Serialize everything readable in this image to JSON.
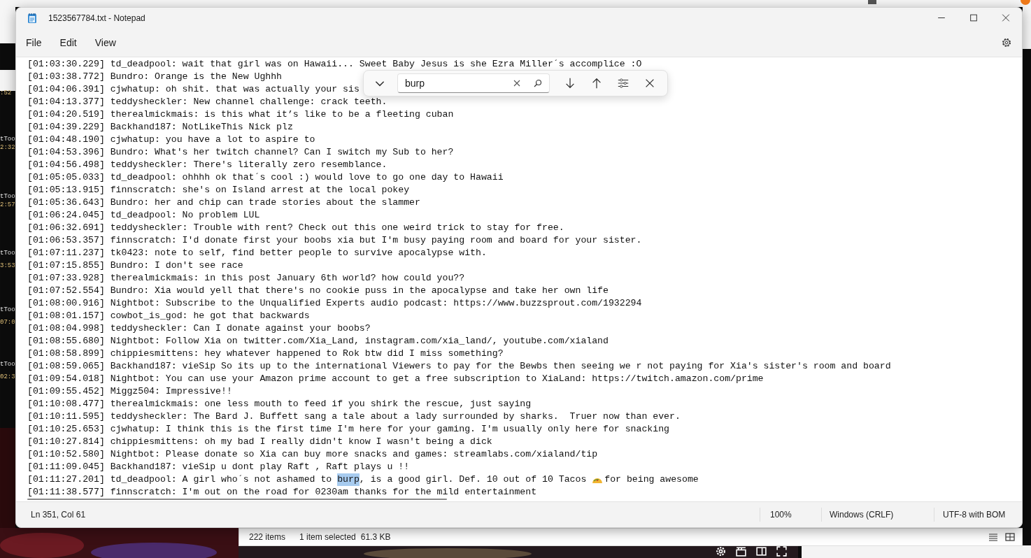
{
  "window": {
    "title": "1523567784.txt - Notepad"
  },
  "menu": [
    {
      "label": "File"
    },
    {
      "label": "Edit"
    },
    {
      "label": "View"
    }
  ],
  "lines": [
    {
      "text": "[01:03:30.229] td_deadpool: wait that girl was on Hawaii... Sweet Baby Jesus is she Ezra Miller´s accomplice :O"
    },
    {
      "text": "[01:03:38.772] Bundro: Orange is the New Ughhh"
    },
    {
      "text": "[01:04:06.391] cjwhatup: oh shit. that was actually your sis"
    },
    {
      "text": "[01:04:13.377] teddysheckler: New channel challenge: crack teeth."
    },
    {
      "text": "[01:04:20.519] therealmickmais: is this what it’s like to be a fleeting cuban"
    },
    {
      "text": "[01:04:39.229] Backhand187: NotLikeThis Nick plz"
    },
    {
      "text": "[01:04:48.190] cjwhatup: you have a lot to aspire to"
    },
    {
      "text": "[01:04:53.396] Bundro: What's her twitch channel? Can I switch my Sub to her?"
    },
    {
      "text": "[01:04:56.498] teddysheckler: There's literally zero resemblance."
    },
    {
      "text": "[01:05:05.033] td_deadpool: ohhhh ok that´s cool :) would love to go one day to Hawaii"
    },
    {
      "text": "[01:05:13.915] finnscratch: she's on Island arrest at the local pokey"
    },
    {
      "text": "[01:05:36.643] Bundro: her and chip can trade stories about the slammer"
    },
    {
      "text": "[01:06:24.045] td_deadpool: No problem LUL"
    },
    {
      "text": "[01:06:32.691] teddysheckler: Trouble with rent? Check out this one weird trick to stay for free."
    },
    {
      "text": "[01:06:53.357] finnscratch: I'd donate first your boobs xia but I'm busy paying room and board for your sister."
    },
    {
      "text": "[01:07:11.237] tk0423: note to self, find better people to survive apocalypse with."
    },
    {
      "text": "[01:07:15.855] Bundro: I don't see race"
    },
    {
      "text": "[01:07:33.928] therealmickmais: in this post January 6th world? how could you??"
    },
    {
      "text": "[01:07:52.554] Bundro: Xia would yell that there's no cookie puss in the apocalypse and take her own life"
    },
    {
      "text": "[01:08:00.916] Nightbot: Subscribe to the Unqualified Experts audio podcast: https://www.buzzsprout.com/1932294"
    },
    {
      "text": "[01:08:01.157] cowbot_is_god: he got that backwards"
    },
    {
      "text": "[01:08:04.998] teddysheckler: Can I donate against your boobs?"
    },
    {
      "text": "[01:08:55.680] Nightbot: Follow Xia on twitter.com/Xia_Land, instagram.com/xia_land/, youtube.com/xialand"
    },
    {
      "text": "[01:08:58.899] chippiesmittens: hey whatever happened to Rok btw did I miss something?"
    },
    {
      "text": "[01:08:59.065] Backhand187: vieSip So its up to the international Viewers to pay for the Bewbs then seeing we r not paying for Xia's sister's room and board"
    },
    {
      "text": "[01:09:54.018] Nightbot: You can use your Amazon prime account to get a free subscription to XiaLand: https://twitch.amazon.com/prime"
    },
    {
      "text": "[01:09:55.452] Miggz504: Impressive!!"
    },
    {
      "text": "[01:10:08.477] therealmickmais: one less mouth to feed if you shirk the rescue, just saying"
    },
    {
      "text": "[01:10:11.595] teddysheckler: The Bard J. Buffett sang a tale about a lady surrounded by sharks.  Truer now than ever."
    },
    {
      "text": "[01:10:25.653] cjwhatup: I think this is the first time I'm here for your gaming. I'm usually only here for snacking"
    },
    {
      "text": "[01:10:27.814] chippiesmittens: oh my bad I really didn't know I wasn't being a dick"
    },
    {
      "text": "[01:10:52.580] Nightbot: Please donate so Xia can buy more snacks and games: streamlabs.com/xialand/tip"
    },
    {
      "text": "[01:11:09.045] Backhand187: vieSip u dont play Raft , Raft plays u !!"
    },
    {
      "segments": [
        {
          "kind": "text",
          "text": "[01:11:27.201] td_deadpool: A girl who´s not ashamed to ",
          "selected": false
        },
        {
          "kind": "text",
          "text": "burp",
          "selected": true
        },
        {
          "kind": "text",
          "text": ", is a good girl. Def. 10 out of 10 Tacos ",
          "selected": false
        },
        {
          "kind": "taco",
          "selected": false
        },
        {
          "kind": "text",
          "text": "for being awesome",
          "selected": false
        }
      ]
    },
    {
      "text": "[01:11:38.577] finnscratch: I'm out on the road for 0230am thanks for the mild entertainment"
    }
  ],
  "find": {
    "value": "burp"
  },
  "status_bar": {
    "position": "Ln 351, Col 61",
    "zoom": "100%",
    "line_ending": "Windows (CRLF)",
    "encoding": "UTF-8 with BOM"
  },
  "explorer_status": {
    "count": "222 items",
    "selection": "1 item selected",
    "size": "61.3 KB"
  },
  "background_fragments": [
    ":52",
    "tToo",
    "2:32",
    "tToo",
    "2:57",
    "tToo",
    "3:53",
    "tToo",
    "07:0",
    "tToo",
    "02:3"
  ]
}
